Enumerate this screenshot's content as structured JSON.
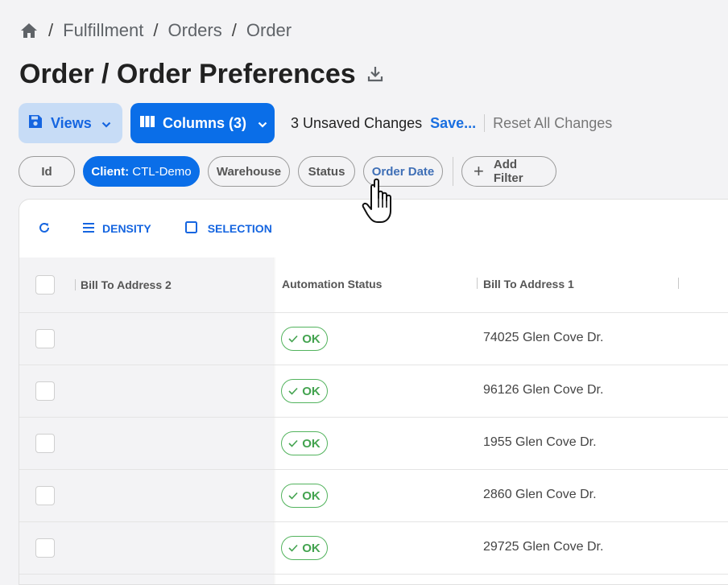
{
  "breadcrumb": {
    "items": [
      "Fulfillment",
      "Orders",
      "Order"
    ],
    "separator": "/"
  },
  "page": {
    "title": "Order / Order Preferences"
  },
  "toolbar": {
    "views_label": "Views",
    "columns_label": "Columns (3)",
    "unsaved_text": "3 Unsaved Changes",
    "save_label": "Save...",
    "reset_label": "Reset All Changes"
  },
  "filters": {
    "id": "Id",
    "client_key": "Client:",
    "client_value": " CTL-Demo",
    "warehouse": "Warehouse",
    "status": "Status",
    "order_date": "Order Date",
    "add_filter": "Add Filter"
  },
  "grid_toolbar": {
    "density": "DENSITY",
    "selection": "SELECTION"
  },
  "columns": [
    "Bill To Address 2",
    "Automation Status",
    "Bill To Address 1"
  ],
  "rows": [
    {
      "bill_to_address_2": "",
      "automation_status": "OK",
      "bill_to_address_1": "74025 Glen Cove Dr."
    },
    {
      "bill_to_address_2": "",
      "automation_status": "OK",
      "bill_to_address_1": "96126 Glen Cove Dr."
    },
    {
      "bill_to_address_2": "",
      "automation_status": "OK",
      "bill_to_address_1": "1955 Glen Cove Dr."
    },
    {
      "bill_to_address_2": "",
      "automation_status": "OK",
      "bill_to_address_1": "2860 Glen Cove Dr."
    },
    {
      "bill_to_address_2": "",
      "automation_status": "OK",
      "bill_to_address_1": "29725 Glen Cove Dr."
    }
  ],
  "colors": {
    "primary": "#0a6ee8",
    "primary_light": "#c7dcf6",
    "ok_green": "#43a34f"
  }
}
